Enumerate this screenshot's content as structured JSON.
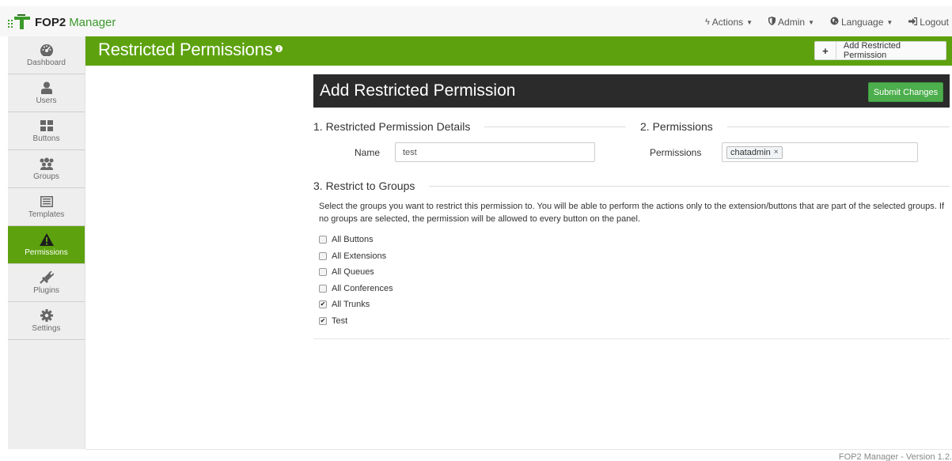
{
  "brand": {
    "strong": "FOP2",
    "light": "Manager"
  },
  "topnav": {
    "actions": "Actions",
    "admin": "Admin",
    "language": "Language",
    "logout": "Logout"
  },
  "sidebar": {
    "items": [
      {
        "label": "Dashboard",
        "icon": "dashboard-icon"
      },
      {
        "label": "Users",
        "icon": "user-icon"
      },
      {
        "label": "Buttons",
        "icon": "grid-icon"
      },
      {
        "label": "Groups",
        "icon": "users-icon"
      },
      {
        "label": "Templates",
        "icon": "template-icon"
      },
      {
        "label": "Permissions",
        "icon": "warning-icon",
        "active": true
      },
      {
        "label": "Plugins",
        "icon": "plug-icon"
      },
      {
        "label": "Settings",
        "icon": "gear-icon"
      }
    ]
  },
  "page": {
    "title": "Restricted Permissions",
    "add_button": "Add Restricted Permission"
  },
  "form": {
    "title": "Add Restricted Permission",
    "submit": "Submit Changes",
    "section1": "1. Restricted Permission Details",
    "section2": "2. Permissions",
    "section3": "3. Restrict to Groups",
    "name_label": "Name",
    "name_value": "test",
    "permissions_label": "Permissions",
    "permissions_tag": "chatadmin",
    "description": "Select the groups you want to restrict this permission to. You will be able to perform the actions only to the extension/buttons that are part of the selected groups. If no groups are selected, the permission will be allowed to every button on the panel.",
    "groups": [
      {
        "label": "All Buttons",
        "checked": false
      },
      {
        "label": "All Extensions",
        "checked": false
      },
      {
        "label": "All Queues",
        "checked": false
      },
      {
        "label": "All Conferences",
        "checked": false
      },
      {
        "label": "All Trunks",
        "checked": true
      },
      {
        "label": "Test",
        "checked": true
      }
    ]
  },
  "footer": "FOP2 Manager - Version 1.2.",
  "colors": {
    "accent_green": "#5da20e",
    "dark_header": "#2b2b2b",
    "submit_green": "#4cae4c"
  }
}
